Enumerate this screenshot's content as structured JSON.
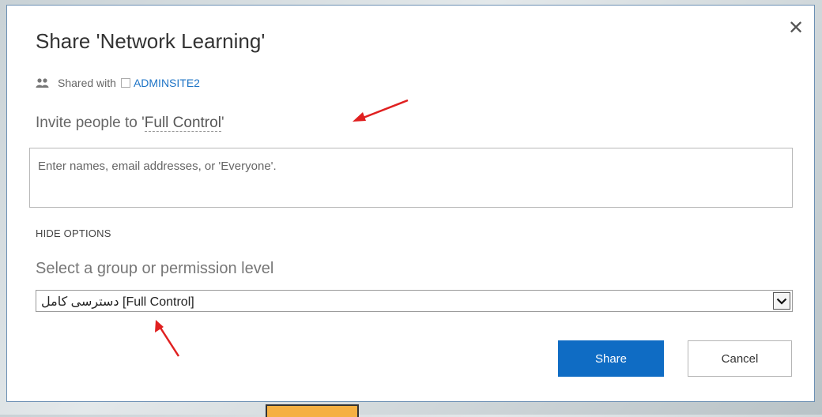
{
  "dialog": {
    "title": "Share 'Network Learning'",
    "close_glyph": "✕",
    "shared_with_label": "Shared with",
    "shared_with_link": "ADMINSITE2",
    "invite_prefix": "Invite people to '",
    "invite_permission": "Full Control",
    "invite_suffix": "'",
    "names_placeholder": "Enter names, email addresses, or 'Everyone'.",
    "hide_options": "HIDE OPTIONS",
    "select_label": "Select a group or permission level",
    "select_value": "دسترسی کامل [Full Control]",
    "share_button": "Share",
    "cancel_button": "Cancel"
  },
  "icons": {
    "people": "people-icon",
    "close": "close-icon",
    "dropdown": "chevron-down-icon"
  },
  "colors": {
    "accent": "#0f6cc4",
    "link": "#1e74c6",
    "annotation_arrow": "#e02020",
    "overlay_tab": "#f5b042"
  }
}
